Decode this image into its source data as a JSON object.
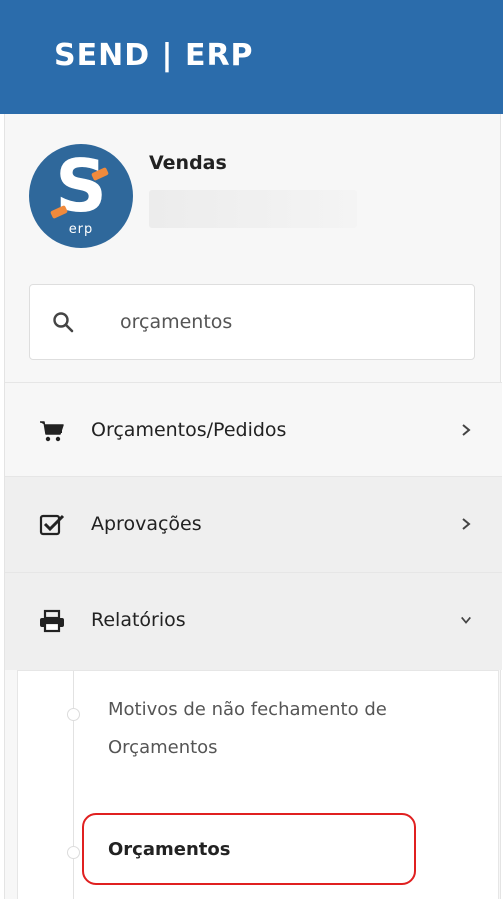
{
  "header": {
    "brand": "SEND | ERP"
  },
  "user": {
    "name": "Vendas",
    "avatar_letter": "S",
    "avatar_caption": "erp",
    "avatar_color": "#2f689b",
    "accent_color": "#f08a3c"
  },
  "search": {
    "value": "orçamentos",
    "icon": "search-icon"
  },
  "menu": {
    "items": [
      {
        "label": "Orçamentos/Pedidos",
        "icon": "cart-icon",
        "state": "collapsed"
      },
      {
        "label": "Aprovações",
        "icon": "checkbox-icon",
        "state": "collapsed"
      },
      {
        "label": "Relatórios",
        "icon": "printer-icon",
        "state": "expanded"
      }
    ],
    "submenu": [
      {
        "label": "Motivos de não fechamento de Orçamentos"
      },
      {
        "label": "Orçamentos",
        "highlighted": true
      }
    ]
  },
  "colors": {
    "header_bg": "#2b6cab",
    "highlight_border": "#e02020"
  }
}
